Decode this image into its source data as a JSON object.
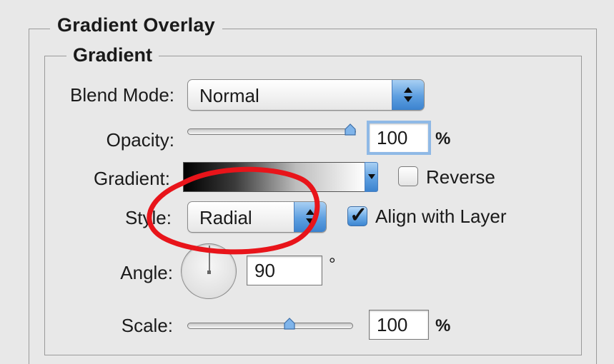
{
  "outer_group": {
    "title": "Gradient Overlay"
  },
  "inner_group": {
    "title": "Gradient"
  },
  "blend_mode": {
    "label": "Blend Mode:",
    "value": "Normal"
  },
  "opacity": {
    "label": "Opacity:",
    "value": "100",
    "unit": "%",
    "slider_fraction": 1.0
  },
  "gradient": {
    "label": "Gradient:",
    "reverse_label": "Reverse",
    "reverse_checked": false
  },
  "style": {
    "label": "Style:",
    "value": "Radial",
    "align_label": "Align with Layer",
    "align_checked": true
  },
  "angle": {
    "label": "Angle:",
    "value": "90",
    "unit": "°"
  },
  "scale": {
    "label": "Scale:",
    "value": "100",
    "unit": "%",
    "slider_fraction": 0.6
  },
  "colors": {
    "accent_blue": "#5d9fe0",
    "annotation_red": "#e8141a",
    "panel_bg": "#e8e8e8"
  },
  "annotation": {
    "shape": "ellipse",
    "target": "style-select"
  }
}
